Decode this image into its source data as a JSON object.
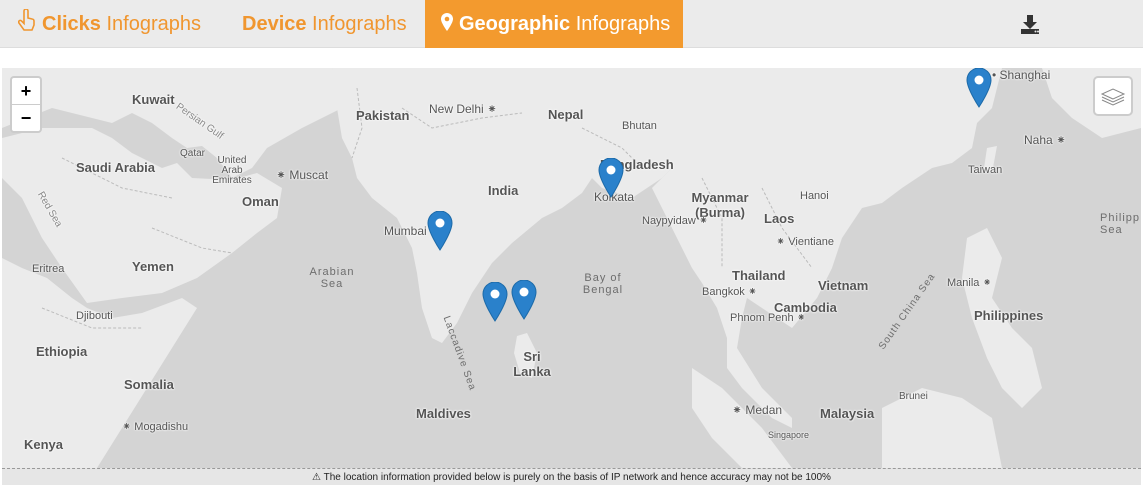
{
  "tabs": [
    {
      "bold": "Clicks",
      "rest": " Infographs",
      "icon": "hand-pointer-icon",
      "active": false
    },
    {
      "bold": "Device",
      "rest": " Infographs",
      "icon": "",
      "active": false
    },
    {
      "bold": "Geographic",
      "rest": " Infographs",
      "icon": "map-marker-icon",
      "active": true
    }
  ],
  "zoom": {
    "in": "+",
    "out": "−"
  },
  "map_labels": {
    "kuwait": "Kuwait",
    "persian_gulf": "Persian Gulf",
    "qatar": "Qatar",
    "uae": "United Arab Emirates",
    "saudi": "Saudi Arabia",
    "muscat": "Muscat",
    "oman": "Oman",
    "red_sea": "Red Sea",
    "eritrea": "Eritrea",
    "yemen": "Yemen",
    "djibouti": "Djibouti",
    "ethiopia": "Ethiopia",
    "somalia": "Somalia",
    "kenya": "Kenya",
    "mogadishu": "Mogadishu",
    "pakistan": "Pakistan",
    "new_delhi": "New Delhi",
    "nepal": "Nepal",
    "bhutan": "Bhutan",
    "bangladesh": "Bangladesh",
    "india": "India",
    "kolkata": "Kolkata",
    "mumbai": "Mumbai",
    "arabian_sea": "Arabian Sea",
    "bay_of_bengal": "Bay of Bengal",
    "laccadive": "Laccadive Sea",
    "sri_lanka": "Sri Lanka",
    "maldives": "Maldives",
    "myanmar": "Myanmar (Burma)",
    "naypyidaw": "Naypyidaw",
    "hanoi": "Hanoi",
    "laos": "Laos",
    "vientiane": "Vientiane",
    "thailand": "Thailand",
    "bangkok": "Bangkok",
    "vietnam": "Vietnam",
    "cambodia": "Cambodia",
    "phnom_penh": "Phnom Penh",
    "medan": "Medan",
    "malaysia": "Malaysia",
    "singapore": "Singapore",
    "brunei": "Brunei",
    "south_china_sea": "South China Sea",
    "manila": "Manila",
    "philippines": "Philippines",
    "taiwan": "Taiwan",
    "naha": "Naha",
    "shanghai": "Shanghai",
    "philipp_sea": "Philipp Sea"
  },
  "markers": [
    "Mumbai",
    "Bengaluru",
    "Chennai",
    "Kolkata",
    "Shanghai"
  ],
  "notice": "The location information provided below is purely on the basis of IP network and hence accuracy may not be 100%",
  "colors": {
    "accent": "#f39a2e",
    "marker": "#2a81cb",
    "land": "#ebebeb",
    "water": "#d4d4d4"
  }
}
